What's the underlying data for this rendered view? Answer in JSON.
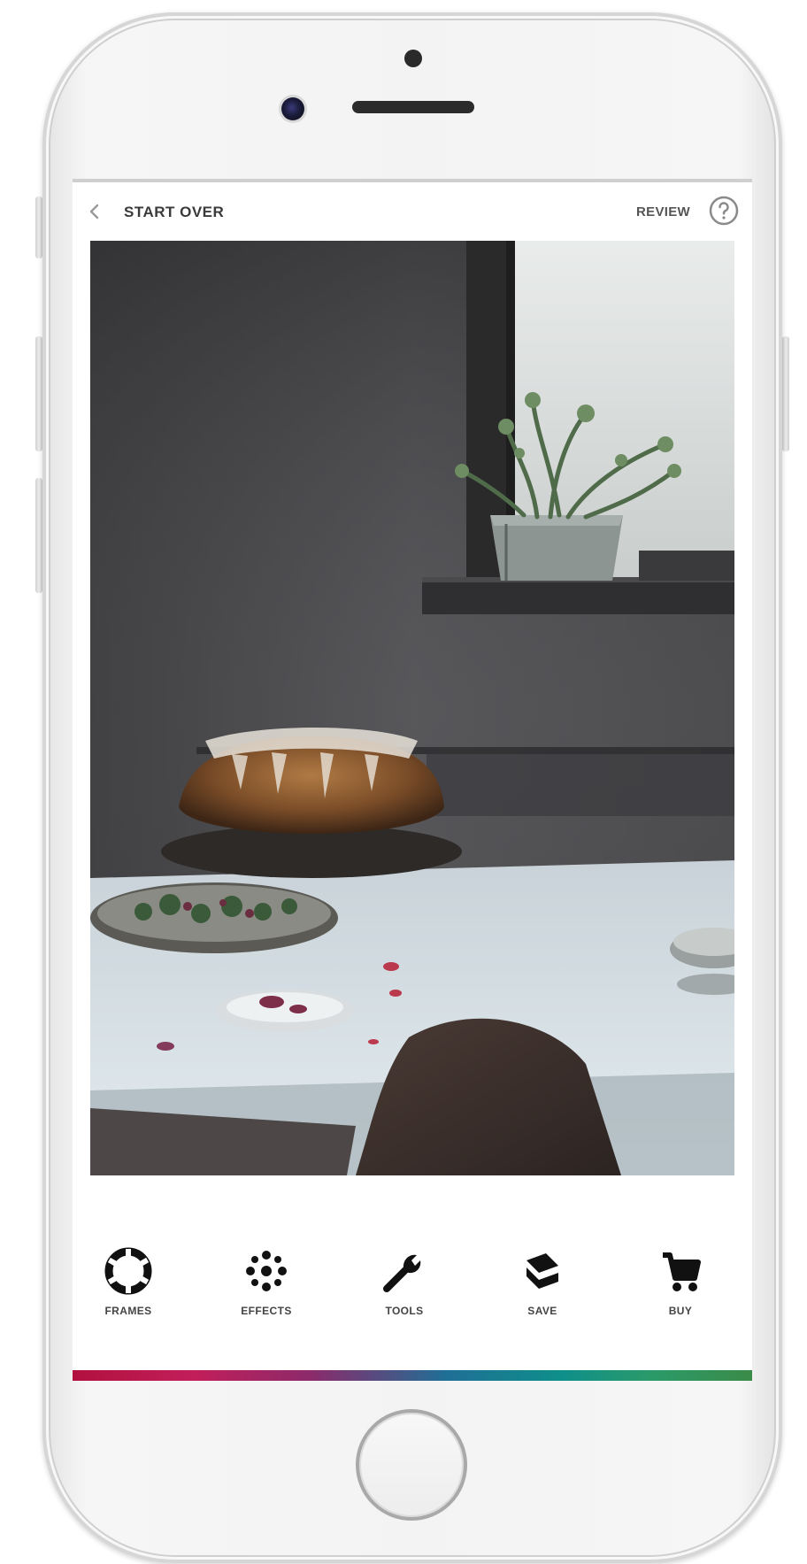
{
  "app": {
    "topbar": {
      "start_over_label": "START OVER",
      "review_label": "REVIEW"
    },
    "photo": {
      "description_icon": "photo-canvas"
    },
    "toolbar": {
      "items": [
        {
          "label": "FRAMES",
          "icon": "frame-ring-icon"
        },
        {
          "label": "EFFECTS",
          "icon": "effects-sparkle-icon"
        },
        {
          "label": "TOOLS",
          "icon": "wrench-icon"
        },
        {
          "label": "SAVE",
          "icon": "layers-icon"
        },
        {
          "label": "BUY",
          "icon": "cart-icon"
        }
      ]
    },
    "colors": {
      "accent_strip": [
        "#b2103f",
        "#8c2a6a",
        "#1f6f96",
        "#0e8f8a",
        "#3b8b48"
      ]
    }
  }
}
